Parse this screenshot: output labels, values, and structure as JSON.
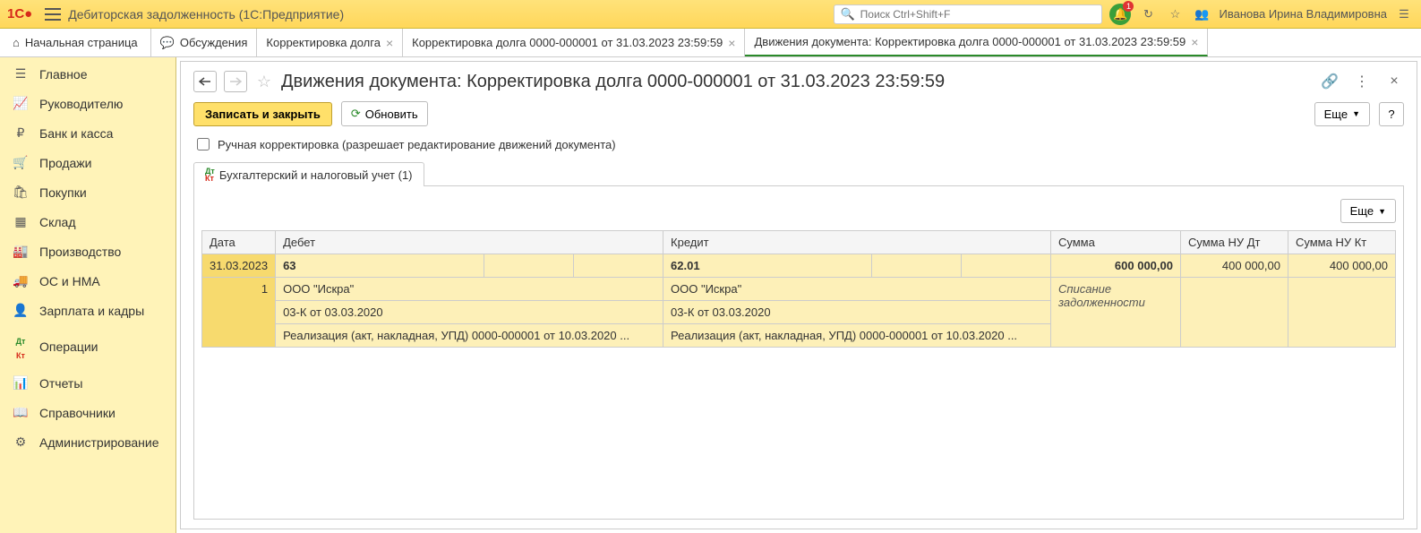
{
  "titlebar": {
    "appTitle": "Дебиторская задолженность  (1С:Предприятие)",
    "searchPlaceholder": "Поиск Ctrl+Shift+F",
    "notifCount": "1",
    "username": "Иванова Ирина Владимировна"
  },
  "tabs": {
    "home": "Начальная страница",
    "discussions": "Обсуждения",
    "t1": "Корректировка долга",
    "t2": "Корректировка долга 0000-000001 от 31.03.2023 23:59:59",
    "t3_active": "Движения документа: Корректировка долга 0000-000001 от 31.03.2023 23:59:59"
  },
  "sidebar": [
    "Главное",
    "Руководителю",
    "Банк и касса",
    "Продажи",
    "Покупки",
    "Склад",
    "Производство",
    "ОС и НМА",
    "Зарплата и кадры",
    "Операции",
    "Отчеты",
    "Справочники",
    "Администрирование"
  ],
  "doc": {
    "title": "Движения документа: Корректировка долга 0000-000001 от 31.03.2023 23:59:59",
    "saveClose": "Записать и закрыть",
    "refresh": "Обновить",
    "more": "Еще",
    "help": "?",
    "manualEdit": "Ручная корректировка (разрешает редактирование движений документа)",
    "tabAccounting": "Бухгалтерский и налоговый учет (1)"
  },
  "table": {
    "headers": {
      "date": "Дата",
      "debit": "Дебет",
      "credit": "Кредит",
      "sum": "Сумма",
      "nudt": "Сумма НУ Дт",
      "nukt": "Сумма НУ Кт"
    },
    "row": {
      "date": "31.03.2023",
      "n": "1",
      "debitAcc": "63",
      "creditAcc": "62.01",
      "sum": "600 000,00",
      "nudt": "400 000,00",
      "nukt": "400 000,00",
      "sumDesc": "Списание задолженности",
      "party": "ООО \"Искра\"",
      "contract": "03-К от 03.03.2020",
      "docref": "Реализация (акт, накладная, УПД) 0000-000001 от 10.03.2020 ..."
    }
  }
}
